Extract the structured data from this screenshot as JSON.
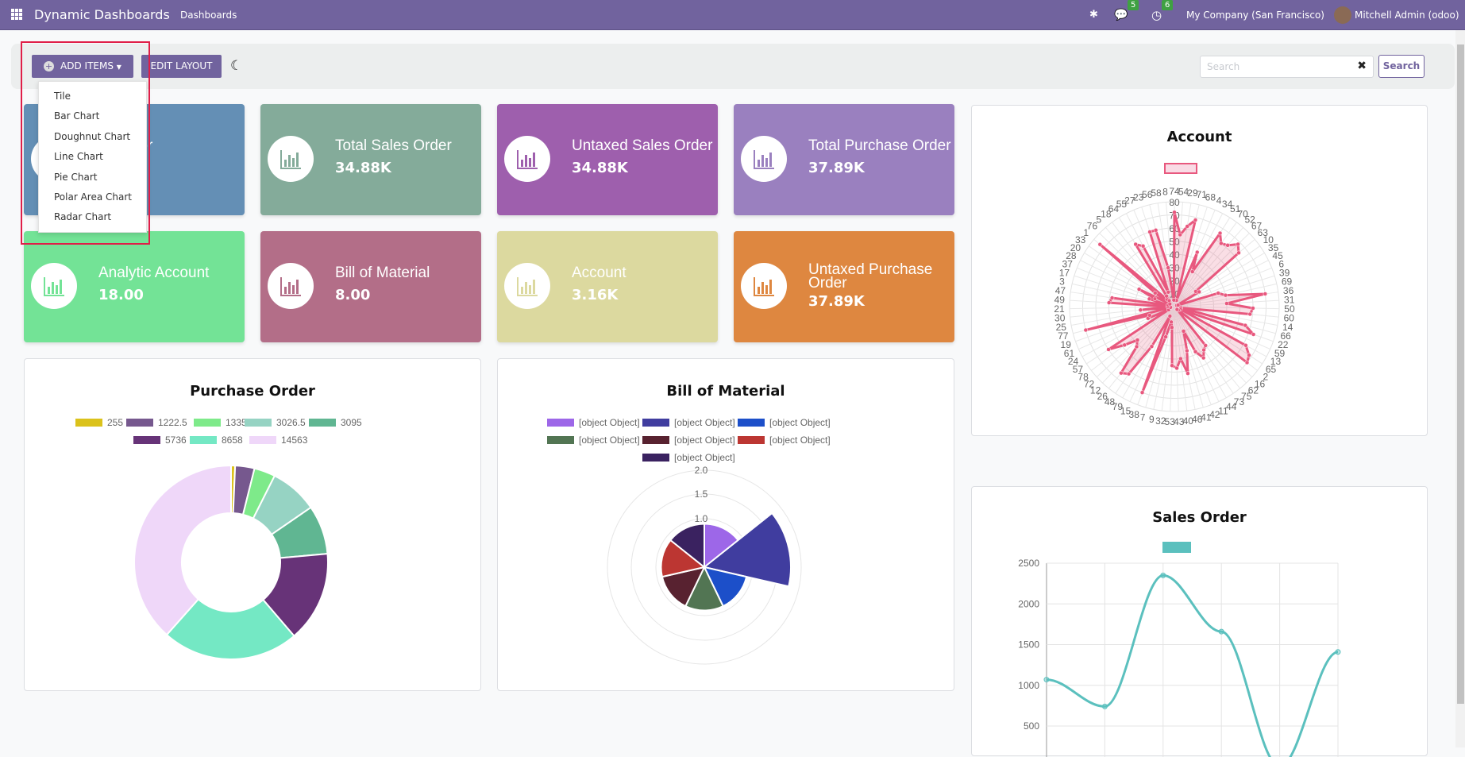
{
  "navbar": {
    "app_name": "Dynamic Dashboards",
    "menu": "Dashboards",
    "messages_count": "5",
    "activities_count": "6",
    "company": "My Company (San Francisco)",
    "user": "Mitchell Admin (odoo)",
    "color": "#71639e"
  },
  "toolbar": {
    "add_items": "ADD ITEMS",
    "edit_layout": "EDIT LAYOUT",
    "search_placeholder": "Search",
    "search_value": "",
    "search_button": "Search"
  },
  "dropdown": {
    "items": [
      "Tile",
      "Bar Chart",
      "Doughnut Chart",
      "Line Chart",
      "Pie Chart",
      "Polar Area Chart",
      "Radar Chart"
    ]
  },
  "tiles": [
    {
      "title": "e Visitor",
      "value": "",
      "color": "#648fb5"
    },
    {
      "title": "Total Sales Order",
      "value": "34.88K",
      "color": "#84ab9a"
    },
    {
      "title": "Untaxed Sales Order",
      "value": "34.88K",
      "color": "#9e5fad"
    },
    {
      "title": "Total Purchase Order",
      "value": "37.89K",
      "color": "#9a80bf"
    },
    {
      "title": "Analytic Account",
      "value": "18.00",
      "color": "#73e396"
    },
    {
      "title": "Bill of Material",
      "value": "8.00",
      "color": "#b36e88"
    },
    {
      "title": "Account",
      "value": "3.16K",
      "color": "#dcd99f"
    },
    {
      "title": "Untaxed Purchase Order",
      "value": "37.89K",
      "color": "#de8740"
    }
  ],
  "chart_data": [
    {
      "type": "radar",
      "title": "Account",
      "color": "#e8587e",
      "rmax": 80,
      "ticks": [
        10,
        20,
        30,
        40,
        50,
        60,
        70,
        80
      ],
      "labels": [
        "74",
        "54",
        "29",
        "71",
        "68",
        "4",
        "34",
        "51",
        "70",
        "52",
        "67",
        "63",
        "10",
        "35",
        "45",
        "6",
        "39",
        "69",
        "36",
        "31",
        "50",
        "60",
        "14",
        "66",
        "22",
        "59",
        "13",
        "65",
        "2",
        "16",
        "62",
        "75",
        "73",
        "44",
        "11",
        "42",
        "41",
        "46",
        "40",
        "43",
        "53",
        "32",
        "9",
        "7",
        "38",
        "15",
        "79",
        "48",
        "26",
        "12",
        "72",
        "78",
        "57",
        "24",
        "61",
        "19",
        "77",
        "25",
        "30",
        "21",
        "49",
        "47",
        "3",
        "17",
        "37",
        "28",
        "20",
        "33",
        "1",
        "76",
        "5",
        "18",
        "64",
        "55",
        "27",
        "23",
        "56",
        "58",
        "8"
      ],
      "values": [
        72,
        55,
        62,
        68,
        5,
        45,
        30,
        66,
        60,
        62,
        68,
        64,
        20,
        22,
        2,
        3,
        35,
        40,
        70,
        40,
        60,
        58,
        5,
        56,
        64,
        5,
        62,
        68,
        70,
        4,
        3,
        38,
        40,
        45,
        38,
        20,
        35,
        52,
        40,
        47,
        45,
        16,
        12,
        24,
        70,
        8,
        35,
        62,
        65,
        42,
        38,
        48,
        60,
        5,
        22,
        20,
        70,
        3,
        26,
        5,
        50,
        48,
        5,
        20,
        16,
        30,
        4,
        18,
        74,
        8,
        6,
        10,
        56,
        52,
        12,
        60,
        60,
        30,
        5
      ]
    },
    {
      "type": "doughnut",
      "title": "Purchase Order",
      "labels": [
        "255",
        "1222.5",
        "1335",
        "3026.5",
        "3095",
        "5736",
        "8658",
        "14563"
      ],
      "values": [
        255,
        1222.5,
        1335,
        3026.5,
        3095,
        5736,
        8658,
        14563
      ],
      "colors": [
        "#dbc21b",
        "#76588e",
        "#7eea8a",
        "#96d3c3",
        "#60b692",
        "#673378",
        "#74e8c4",
        "#efd7f9"
      ]
    },
    {
      "type": "polarArea",
      "title": "Bill of Material",
      "labels": [
        "[object Object]",
        "[object Object]",
        "[object Object]",
        "[object Object]",
        "[object Object]",
        "[object Object]",
        "[object Object]"
      ],
      "values": [
        1,
        2,
        1,
        1,
        1,
        1,
        1
      ],
      "ticks": [
        "1.0",
        "1.5",
        "2.0"
      ],
      "colors": [
        "#9d67e8",
        "#403d9f",
        "#1c4fc9",
        "#527553",
        "#582230",
        "#bc3632",
        "#3a2260"
      ]
    },
    {
      "type": "line",
      "title": "Sales Order",
      "color": "#5bc0be",
      "values": [
        1070,
        740,
        2350,
        1660,
        0,
        1410
      ],
      "yticks": [
        "500",
        "1000",
        "1500",
        "2000",
        "2500"
      ],
      "ylim": [
        0,
        2500
      ]
    }
  ]
}
